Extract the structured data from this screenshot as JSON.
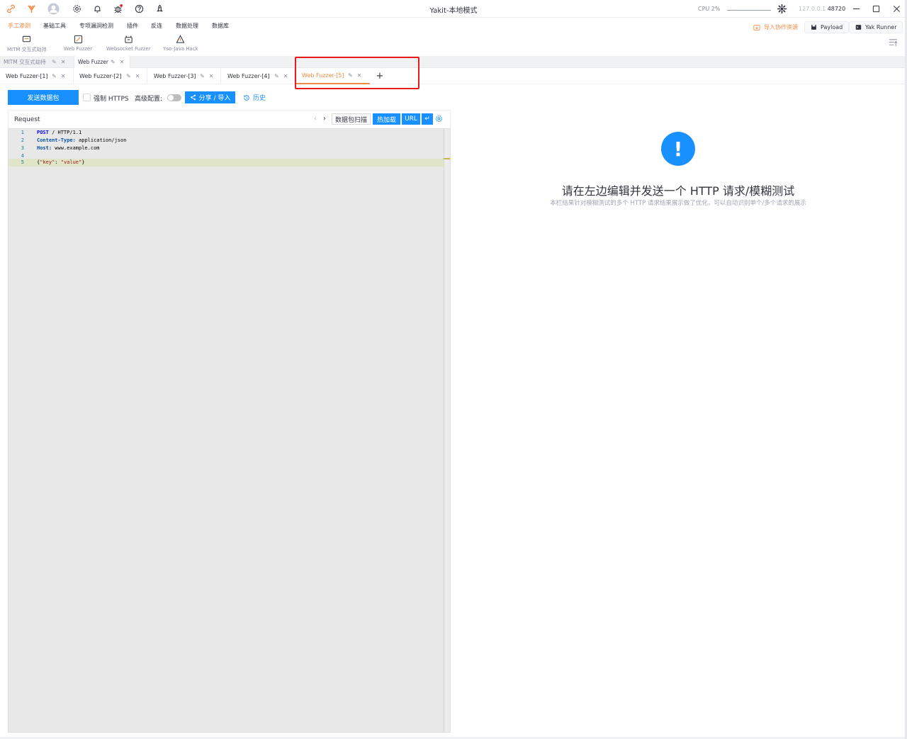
{
  "window": {
    "title": "Yakit-本地模式",
    "cpu": "CPU 2%",
    "host": "127.0.0.1",
    "port": "48720"
  },
  "menu": {
    "items": [
      "手工渗测",
      "基础工具",
      "专项漏洞检测",
      "插件",
      "反连",
      "数据处理",
      "数据库"
    ],
    "active": "手工渗测",
    "tools": [
      "MITM 交互式劫持",
      "Web Fuzzer",
      "Websocket Fuzzer",
      "Yso-Java Hack"
    ],
    "import_resources": "导入协作资源",
    "payload": "Payload",
    "yak_runner": "Yak Runner"
  },
  "tabs_top": [
    {
      "label": "MITM 交互式劫持",
      "active": false
    },
    {
      "label": "Web Fuzzer",
      "active": true
    }
  ],
  "tabs_sub": [
    {
      "label": "Web Fuzzer-[1]",
      "active": false
    },
    {
      "label": "Web Fuzzer-[2]",
      "active": false
    },
    {
      "label": "Web Fuzzer-[3]",
      "active": false
    },
    {
      "label": "Web Fuzzer-[4]",
      "active": false
    },
    {
      "label": "Web Fuzzer-[5]",
      "active": true
    }
  ],
  "add_tab": "+",
  "toolbar": {
    "send": "发送数据包",
    "force_https": "强制 HTTPS",
    "advanced": "高级配置:",
    "share": "分享 / 导入",
    "history": "历史"
  },
  "request": {
    "title": "Request",
    "scan": "数据包扫描",
    "hot_load": "热加载",
    "url": "URL",
    "newline_icon": "↵",
    "lines": [
      {
        "n": "1",
        "method": "POST",
        "rest": " / HTTP/1.1"
      },
      {
        "n": "2",
        "key": "Content-Type:",
        "val": " application/json"
      },
      {
        "n": "3",
        "key": "Host:",
        "val": " www.example.com"
      },
      {
        "n": "4",
        "text": ""
      },
      {
        "n": "5",
        "body_prefix": "{",
        "body_key": "\"key\"",
        "body_mid": ": ",
        "body_val": "\"value\"",
        "body_suffix": "}"
      }
    ]
  },
  "response": {
    "title": "请在左边编辑并发送一个 HTTP 请求/模糊测试",
    "subtitle": "本栏结果针对模糊测试的多个 HTTP 请求结果展示做了优化，可以自动识别单个/多个请求的展示"
  },
  "colors": {
    "accent": "#f28b44",
    "primary": "#1890ff",
    "highlight": "#ea1b1b"
  }
}
